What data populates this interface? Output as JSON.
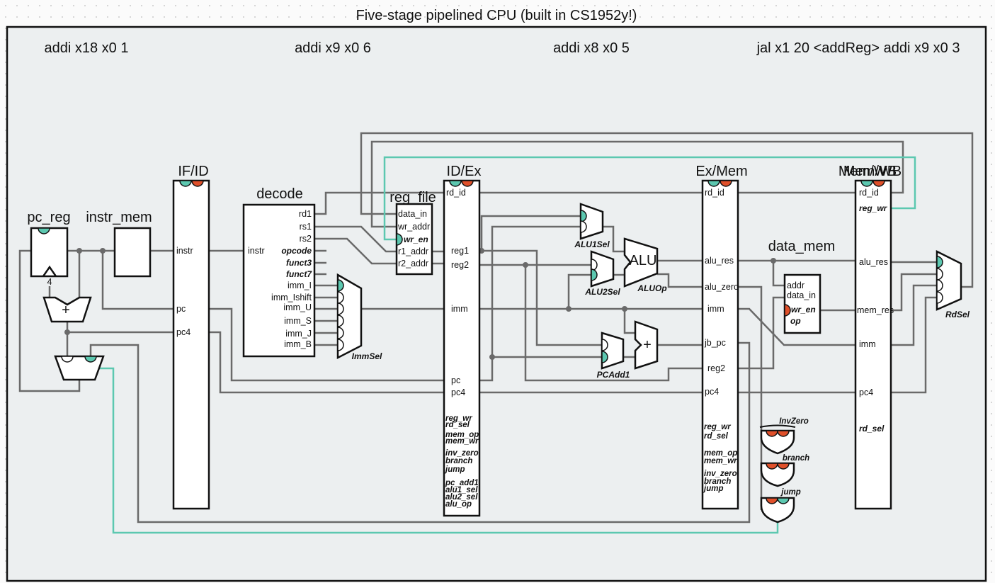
{
  "title": "Five-stage pipelined CPU (built in CS1952y!)",
  "instructions": [
    "addi x18 x0 1",
    "addi x9 x0 6",
    "addi x8 x0 5",
    "jal x1 20 <addReg> addi x9 x0 3"
  ],
  "colors": {
    "enable": "#5cc8b0",
    "disabled": "#e0502a",
    "wire": "#6a6a6a",
    "panel": "#eceff0"
  },
  "pc_reg": {
    "label": "pc_reg",
    "constant": "4",
    "adder": "+"
  },
  "instr_mem": {
    "label": "instr_mem"
  },
  "if_id": {
    "label": "IF/ID",
    "ports": [
      "instr",
      "pc",
      "pc4"
    ]
  },
  "decode": {
    "label": "decode",
    "in": "instr",
    "ports": [
      "rd1",
      "rs1",
      "rs2",
      "opcode",
      "funct3",
      "funct7",
      "imm_I",
      "imm_Ishift",
      "imm_U",
      "imm_S",
      "imm_J",
      "imm_B"
    ]
  },
  "imm_sel": {
    "label": "ImmSel"
  },
  "reg_file": {
    "label": "reg_file",
    "ports": [
      "data_in",
      "wr_addr",
      "wr_en",
      "r1_addr",
      "r2_addr"
    ]
  },
  "id_ex": {
    "label": "ID/Ex",
    "ports": [
      "rd_id",
      "reg1",
      "reg2",
      "imm",
      "pc",
      "pc4"
    ],
    "controls": [
      "reg_wr",
      "rd_sel",
      "mem_op",
      "mem_wr",
      "inv_zero",
      "branch",
      "jump",
      "pc_add1",
      "alu1_sel",
      "alu2_sel",
      "alu_op"
    ]
  },
  "alu1_sel": {
    "label": "ALU1Sel"
  },
  "alu2_sel": {
    "label": "ALU2Sel"
  },
  "alu": {
    "label": "ALU",
    "op": "ALUOp"
  },
  "pc_add1": {
    "label": "PCAdd1",
    "adder": "+"
  },
  "ex_mem": {
    "label": "Ex/Mem",
    "ports": [
      "rd_id",
      "alu_res",
      "alu_zero",
      "imm",
      "jb_pc",
      "reg2",
      "pc4"
    ],
    "controls": [
      "reg_wr",
      "rd_sel",
      "mem_op",
      "mem_wr",
      "inv_zero",
      "branch",
      "jump"
    ]
  },
  "data_mem": {
    "label": "data_mem",
    "ports": [
      "addr",
      "data_in",
      "wr_en",
      "op"
    ]
  },
  "mem_wb": {
    "label": "Mem/WB",
    "ports": [
      "rd_id",
      "reg_wr",
      "alu_res",
      "mem_res",
      "imm",
      "pc4",
      "rd_sel"
    ]
  },
  "rd_sel": {
    "label": "RdSel"
  },
  "gates": {
    "inv_zero": "InvZero",
    "branch": "branch",
    "jump": "jump"
  }
}
